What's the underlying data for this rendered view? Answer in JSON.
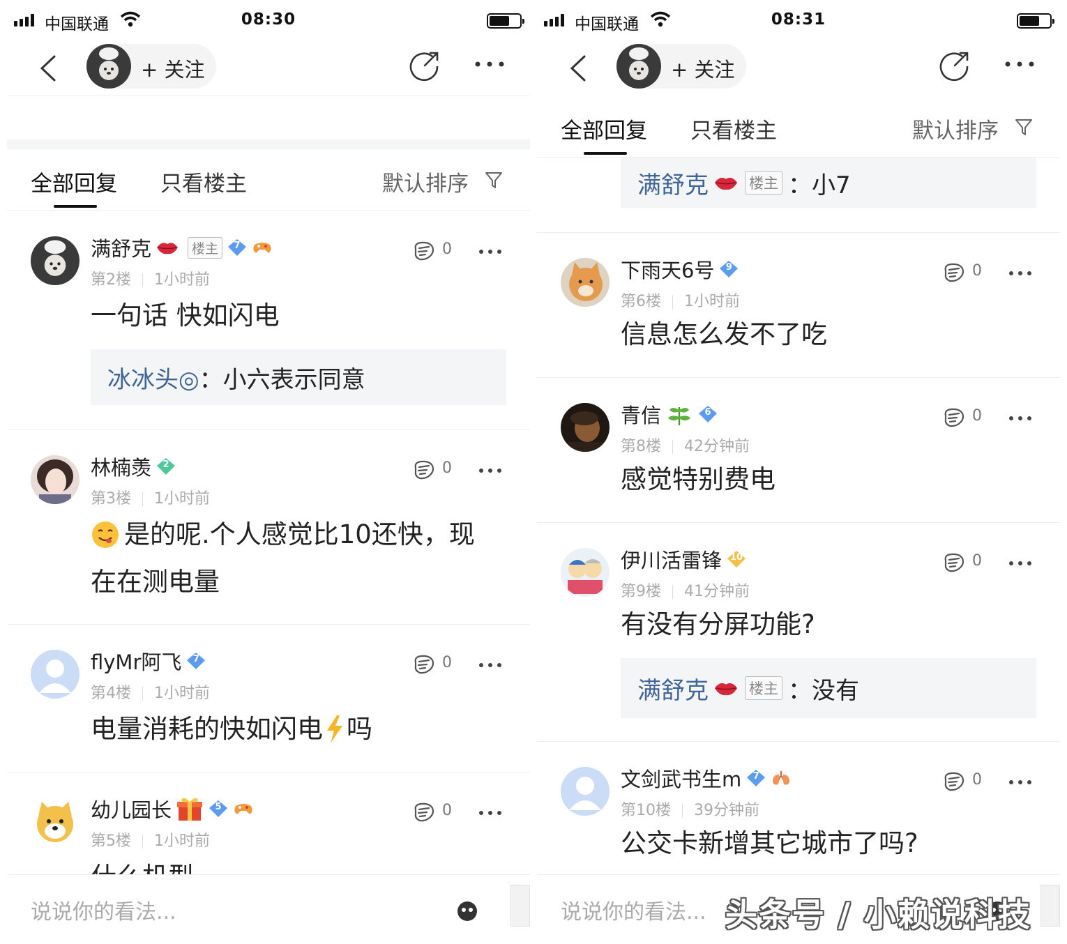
{
  "left": {
    "status": {
      "carrier": "中国联通",
      "time": "08:30"
    },
    "nav": {
      "follow_label": "+ 关注"
    },
    "tabs": {
      "all": "全部回复",
      "host_only": "只看楼主",
      "sort": "默认排序"
    },
    "comments": [
      {
        "name": "满舒克",
        "host_badge": "楼主",
        "level": "7",
        "floor": "第2楼",
        "time": "1小时前",
        "likes": "0",
        "content": "一句话 快如闪电",
        "quote": {
          "name": "冰冰头◎",
          "sep": "：",
          "text": "小六表示同意"
        }
      },
      {
        "name": "林楠羡",
        "level": "2",
        "floor": "第3楼",
        "time": "1小时前",
        "likes": "0",
        "content_line1": "是的呢.个人感觉比10还快，现",
        "content_line2": "在在测电量"
      },
      {
        "name": "flyMr阿飞",
        "level": "7",
        "floor": "第4楼",
        "time": "1小时前",
        "likes": "0",
        "content_a": "电量消耗的快如闪电",
        "content_b": "吗"
      },
      {
        "name": "幼儿园长",
        "level": "5",
        "floor": "第5楼",
        "time": "1小时前",
        "likes": "0",
        "content": "什么机型"
      }
    ],
    "bottom": {
      "placeholder": "说说你的看法..."
    }
  },
  "right": {
    "status": {
      "carrier": "中国联通",
      "time": "08:31"
    },
    "nav": {
      "follow_label": "+ 关注"
    },
    "tabs": {
      "all": "全部回复",
      "host_only": "只看楼主",
      "sort": "默认排序"
    },
    "top_quote": {
      "name": "满舒克",
      "host_badge": "楼主",
      "sep": "：",
      "text": "小7"
    },
    "comments": [
      {
        "name": "下雨天6号",
        "level": "9",
        "floor": "第6楼",
        "time": "1小时前",
        "likes": "0",
        "content": "信息怎么发不了吃"
      },
      {
        "name": "青信",
        "level": "6",
        "floor": "第8楼",
        "time": "42分钟前",
        "likes": "0",
        "content": "感觉特别费电"
      },
      {
        "name": "伊川活雷锋",
        "level": "10",
        "floor": "第9楼",
        "time": "41分钟前",
        "likes": "0",
        "content": "有没有分屏功能?",
        "quote": {
          "name": "满舒克",
          "host_badge": "楼主",
          "sep": "：",
          "text": "没有"
        }
      },
      {
        "name": "文剑武书生m",
        "level": "7",
        "floor": "第10楼",
        "time": "39分钟前",
        "likes": "0",
        "content": "公交卡新增其它城市了吗?"
      }
    ],
    "bottom": {
      "placeholder": "说说你的看法..."
    }
  },
  "watermark": "头条号 / 小赖说科技",
  "colors": {
    "link_blue": "#406599",
    "quote_bg": "#f4f5f6",
    "diamond_blue": "#5b9bf0",
    "diamond_green": "#4cc99a",
    "diamond_gold": "#f5c048"
  }
}
